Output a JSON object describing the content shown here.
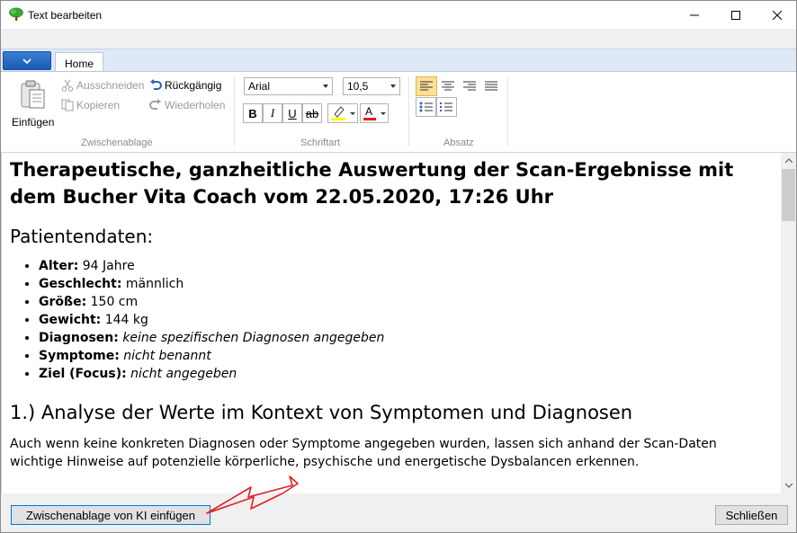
{
  "window": {
    "title": "Text bearbeiten",
    "controls": {
      "minimize": "minimize-icon",
      "maximize": "maximize-icon",
      "close": "close-icon"
    }
  },
  "ribbon": {
    "tabs": [
      {
        "label": "Home"
      }
    ],
    "clipboard": {
      "group_label": "Zwischenablage",
      "paste_label": "Einfügen",
      "cut_label": "Ausschneiden",
      "copy_label": "Kopieren",
      "undo_label": "Rückgängig",
      "redo_label": "Wiederholen"
    },
    "font": {
      "group_label": "Schriftart",
      "font_family": "Arial",
      "font_size": "10,5",
      "bold": "B",
      "italic": "I",
      "underline": "U",
      "strike": "ab",
      "font_color_letter": "A"
    },
    "paragraph": {
      "group_label": "Absatz",
      "active_alignment": "left"
    }
  },
  "document": {
    "title": "Therapeutische, ganzheitliche Auswertung der Scan-Ergebnisse mit dem Bucher Vita Coach vom 22.05.2020, 17:26 Uhr",
    "section_patient": "Patientendaten:",
    "patient_items": [
      {
        "key": "Alter:",
        "value": " 94 Jahre",
        "italic": false
      },
      {
        "key": "Geschlecht:",
        "value": " männlich",
        "italic": false
      },
      {
        "key": "Größe:",
        "value": " 150 cm",
        "italic": false
      },
      {
        "key": "Gewicht:",
        "value": " 144 kg",
        "italic": false
      },
      {
        "key": "Diagnosen:",
        "value": " keine spezifischen Diagnosen angegeben",
        "italic": true
      },
      {
        "key": "Symptome:",
        "value": " nicht benannt",
        "italic": true
      },
      {
        "key": "Ziel (Focus):",
        "value": " nicht angegeben",
        "italic": true
      }
    ],
    "section_analysis": "1.) Analyse der Werte im Kontext von Symptomen und Diagnosen",
    "paragraph_1": "Auch wenn keine konkreten Diagnosen oder Symptome angegeben wurden, lassen sich anhand der Scan-Daten",
    "paragraph_2": "wichtige Hinweise auf potenzielle körperliche, psychische und energetische Dysbalancen erkennen."
  },
  "footer": {
    "paste_ki_label": "Zwischenablage von KI einfügen",
    "close_label": "Schließen"
  },
  "colors": {
    "highlight": "#ffff00",
    "font_color": "#ff0000",
    "annotation_arrow": "#e02020",
    "focus_border": "#0078d7"
  }
}
